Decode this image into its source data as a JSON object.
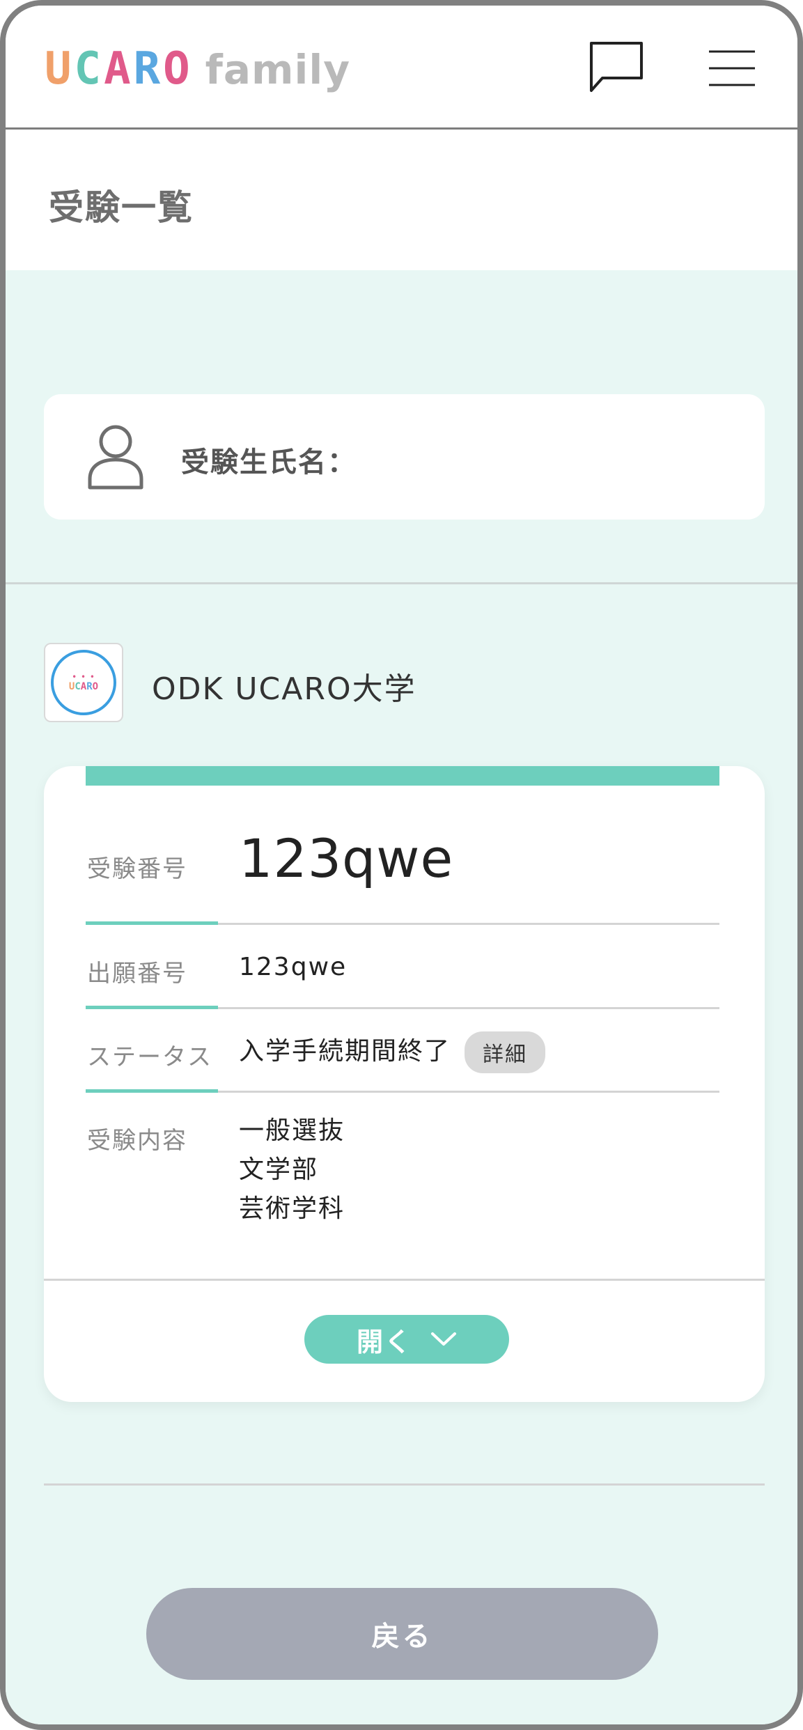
{
  "header": {
    "logo_letters": [
      {
        "char": "U",
        "color": "#f0a06a"
      },
      {
        "char": "C",
        "color": "#63c5b4"
      },
      {
        "char": "A",
        "color": "#e05a8a"
      },
      {
        "char": "R",
        "color": "#5aa7e0"
      },
      {
        "char": "O",
        "color": "#e05a8a"
      }
    ],
    "logo_suffix": "family",
    "chat_icon": "speech-bubble-icon",
    "menu_icon": "hamburger-menu-icon"
  },
  "page": {
    "title": "受験一覧"
  },
  "examinee": {
    "icon": "person-icon",
    "label": "受験生氏名："
  },
  "university": {
    "logo_text": "UCARO",
    "name": "ODK UCARO大学"
  },
  "exam_card": {
    "exam_number_label": "受験番号",
    "exam_number_value": "123qwe",
    "application_number_label": "出願番号",
    "application_number_value": "123qwe",
    "status_label": "ステータス",
    "status_value": "入学手続期間終了",
    "detail_label": "詳細",
    "content_label": "受験内容",
    "content_lines": [
      "一般選抜",
      "文学部",
      "芸術学科"
    ],
    "open_label": "開く",
    "open_icon": "chevron-down-icon"
  },
  "footer": {
    "back_label": "戻る"
  },
  "colors": {
    "accent_mint": "#6dcfbd",
    "background_mint": "#e8f7f4",
    "back_button": "#a4a8b4"
  }
}
